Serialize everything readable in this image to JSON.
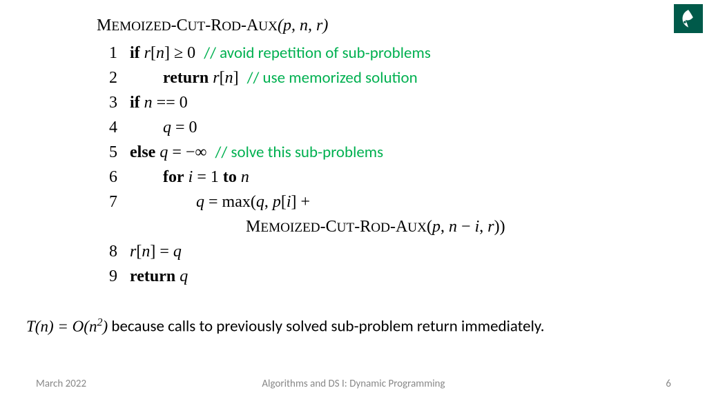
{
  "algorithm": {
    "name": "Memoized-Cut-Rod-Aux",
    "params": "(p, n, r)",
    "lines": [
      {
        "n": "1",
        "code": "if r[n] ≥ 0",
        "comment": "// avoid repetition of sub-problems",
        "indent": 0,
        "bold_start": true
      },
      {
        "n": "2",
        "code": "return r[n]",
        "comment": "// use memorized solution",
        "indent": 2,
        "bold_start": true
      },
      {
        "n": "3",
        "code": "if n == 0",
        "indent": 0,
        "bold_start": true
      },
      {
        "n": "4",
        "code": "q = 0",
        "indent": 2
      },
      {
        "n": "5",
        "code": "else q = −∞",
        "comment": "// solve this sub-problems",
        "indent": 0,
        "bold_start": true
      },
      {
        "n": "6",
        "code": "for i = 1 to n",
        "indent": 2,
        "bold_start": true
      },
      {
        "n": "7",
        "code": "q = max(q, p[i] +",
        "indent": 4
      },
      {
        "n": "",
        "code": "Memoized-Cut-Rod-Aux(p, n − i, r))",
        "indent": 8,
        "sc": true
      },
      {
        "n": "8",
        "code": "r[n] = q",
        "indent": 0
      },
      {
        "n": "9",
        "code": "return q",
        "indent": 0,
        "bold_start": true
      }
    ]
  },
  "complexity": {
    "formula": "T(n) = O(n²)",
    "text": " because calls to previously solved sub-problem return immediately."
  },
  "footer": {
    "left": "March 2022",
    "center": "Algorithms and DS I: Dynamic Programming",
    "right": "6"
  }
}
